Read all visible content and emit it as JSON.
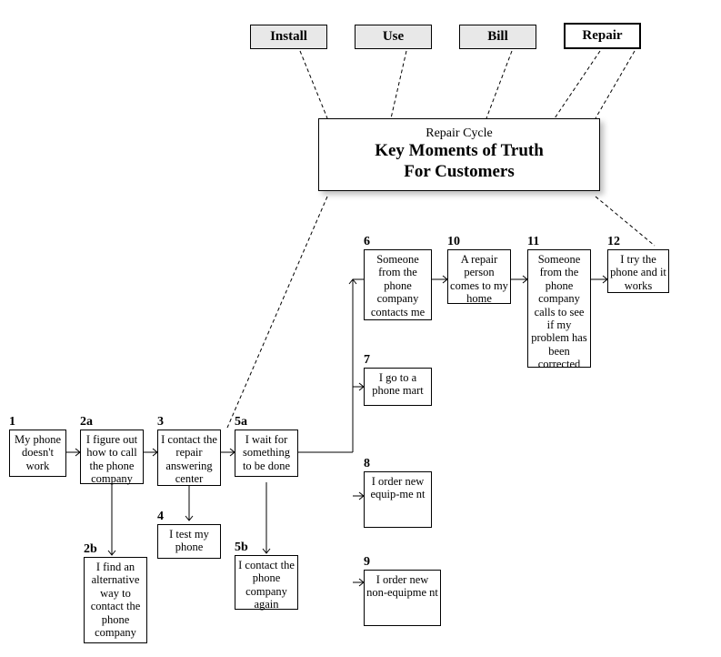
{
  "tabs": {
    "install": "Install",
    "use": "Use",
    "bill": "Bill",
    "repair": "Repair"
  },
  "title": {
    "line1": "Repair Cycle",
    "line2": "Key Moments of Truth",
    "line3": "For Customers"
  },
  "nodes": {
    "n1": {
      "label": "1",
      "text": "My phone doesn't work"
    },
    "n2a": {
      "label": "2a",
      "text": "I figure out how to call the phone company"
    },
    "n2b": {
      "label": "2b",
      "text": "I find an alternative way to contact the phone company"
    },
    "n3": {
      "label": "3",
      "text": "I contact the repair answering center"
    },
    "n4": {
      "label": "4",
      "text": "I test my phone"
    },
    "n5a": {
      "label": "5a",
      "text": "I wait for something to be done"
    },
    "n5b": {
      "label": "5b",
      "text": "I contact the phone company again"
    },
    "n6": {
      "label": "6",
      "text": "Someone from the phone company contacts me"
    },
    "n7": {
      "label": "7",
      "text": "I go to a phone mart"
    },
    "n8": {
      "label": "8",
      "text": "I order new equip-me nt"
    },
    "n9": {
      "label": "9",
      "text": "I order new non-equipme nt"
    },
    "n10": {
      "label": "10",
      "text": "A repair person comes to my home"
    },
    "n11": {
      "label": "11",
      "text": "Someone from the phone company calls to see if my problem has been corrected"
    },
    "n12": {
      "label": "12",
      "text": "I try the phone and it works"
    }
  }
}
